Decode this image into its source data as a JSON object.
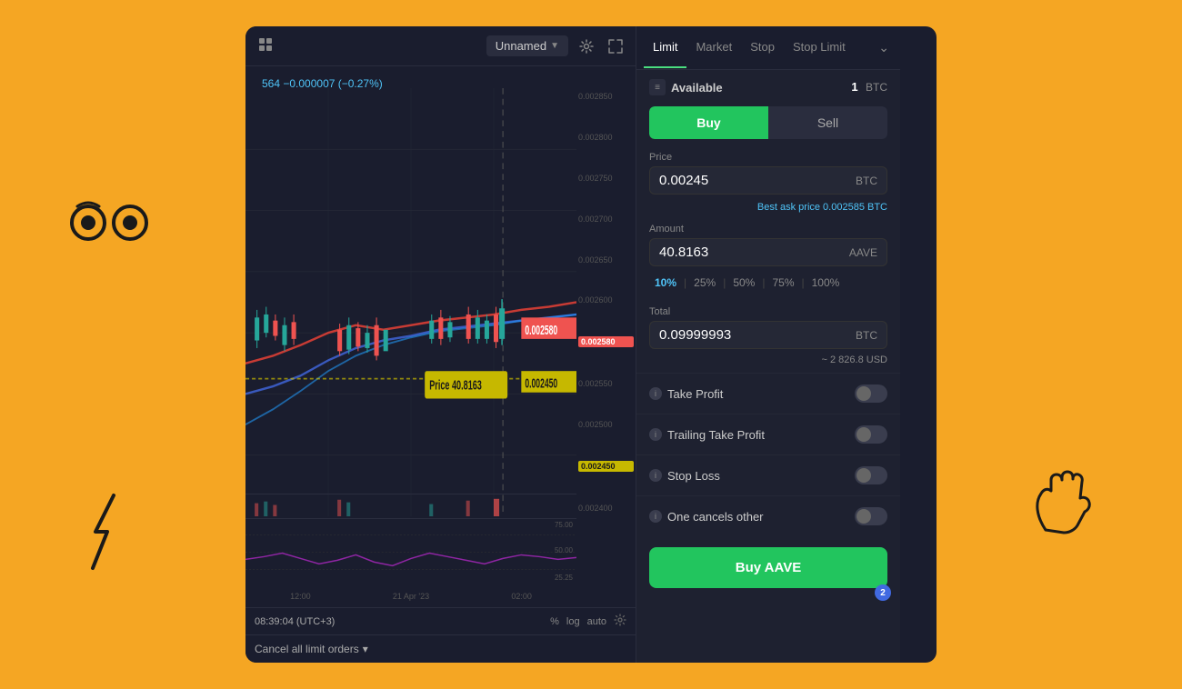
{
  "page": {
    "background_color": "#F5A623"
  },
  "chart": {
    "name_placeholder": "Unnamed",
    "price_label": "564  −0.000007 (−0.27%)",
    "current_price": "0.002580",
    "limit_price": "0.002450",
    "price_axis": [
      "0.002850",
      "0.002800",
      "0.002750",
      "0.002700",
      "0.002650",
      "0.002600",
      "0.002550",
      "0.002500",
      "0.002450",
      "0.002400"
    ],
    "time_labels": [
      "12:00",
      "21 Apr '23",
      "02:00"
    ],
    "time_utc": "08:39:04 (UTC+3)",
    "chart_tools": [
      "%",
      "log",
      "auto"
    ],
    "tooltip_price": "Price",
    "tooltip_amount": "40.8163",
    "cancel_orders": "Cancel all limit orders",
    "oscillator_levels": [
      "75.00",
      "50.00",
      "25.25"
    ]
  },
  "order_form": {
    "tabs": [
      {
        "label": "Limit",
        "active": true
      },
      {
        "label": "Market",
        "active": false
      },
      {
        "label": "Stop",
        "active": false
      },
      {
        "label": "Stop Limit",
        "active": false
      }
    ],
    "available_label": "Available",
    "available_amount": "1",
    "available_currency": "BTC",
    "buy_label": "Buy",
    "sell_label": "Sell",
    "price_label": "Price",
    "price_value": "0.00245",
    "price_currency": "BTC",
    "best_ask_text": "Best ask price 0.002585 BTC",
    "amount_label": "Amount",
    "amount_value": "40.8163",
    "amount_currency": "AAVE",
    "percentages": [
      "10%",
      "25%",
      "50%",
      "75%",
      "100%"
    ],
    "active_pct": "10%",
    "total_label": "Total",
    "total_value": "0.09999993",
    "total_currency": "BTC",
    "total_usd": "~ 2 826.8 USD",
    "toggles": [
      {
        "label": "Take Profit",
        "enabled": false
      },
      {
        "label": "Trailing Take Profit",
        "enabled": false
      },
      {
        "label": "Stop Loss",
        "enabled": false
      },
      {
        "label": "One cancels other",
        "enabled": false
      }
    ],
    "buy_action_label": "Buy AAVE",
    "notification_count": "2"
  }
}
